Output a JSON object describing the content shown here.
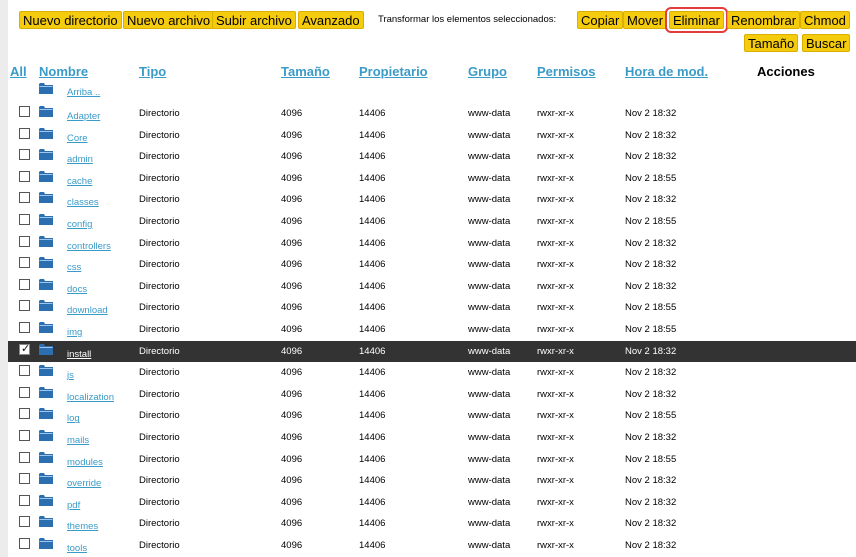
{
  "toolbar": {
    "new_dir": "Nuevo directorio",
    "new_file": "Nuevo archivo",
    "upload": "Subir archivo",
    "advanced": "Avanzado",
    "transform_label": "Transformar los elementos seleccionados:",
    "copy": "Copiar",
    "move": "Mover",
    "delete": "Eliminar",
    "rename": "Renombrar",
    "chmod": "Chmod",
    "size": "Tamaño",
    "search": "Buscar"
  },
  "headers": {
    "all": "All",
    "name": "Nombre",
    "type": "Tipo",
    "size": "Tamaño",
    "owner": "Propietario",
    "group": "Grupo",
    "perms": "Permisos",
    "modified": "Hora de mod.",
    "actions": "Acciones"
  },
  "up_link": "Arriba ..",
  "colors": {
    "button": "#f5cb0d",
    "link": "#3a9bc8",
    "selected_row": "#333333",
    "highlight": "#e23c3c",
    "folder": "#2c6fb0"
  },
  "rows": [
    {
      "name": "Adapter",
      "type": "Directorio",
      "size": "4096",
      "owner": "14406",
      "group": "www-data",
      "perms": "rwxr-xr-x",
      "modified": "Nov 2 18:32",
      "checked": false
    },
    {
      "name": "Core",
      "type": "Directorio",
      "size": "4096",
      "owner": "14406",
      "group": "www-data",
      "perms": "rwxr-xr-x",
      "modified": "Nov 2 18:32",
      "checked": false
    },
    {
      "name": "admin",
      "type": "Directorio",
      "size": "4096",
      "owner": "14406",
      "group": "www-data",
      "perms": "rwxr-xr-x",
      "modified": "Nov 2 18:32",
      "checked": false
    },
    {
      "name": "cache",
      "type": "Directorio",
      "size": "4096",
      "owner": "14406",
      "group": "www-data",
      "perms": "rwxr-xr-x",
      "modified": "Nov 2 18:55",
      "checked": false
    },
    {
      "name": "classes",
      "type": "Directorio",
      "size": "4096",
      "owner": "14406",
      "group": "www-data",
      "perms": "rwxr-xr-x",
      "modified": "Nov 2 18:32",
      "checked": false
    },
    {
      "name": "config",
      "type": "Directorio",
      "size": "4096",
      "owner": "14406",
      "group": "www-data",
      "perms": "rwxr-xr-x",
      "modified": "Nov 2 18:55",
      "checked": false
    },
    {
      "name": "controllers",
      "type": "Directorio",
      "size": "4096",
      "owner": "14406",
      "group": "www-data",
      "perms": "rwxr-xr-x",
      "modified": "Nov 2 18:32",
      "checked": false
    },
    {
      "name": "css",
      "type": "Directorio",
      "size": "4096",
      "owner": "14406",
      "group": "www-data",
      "perms": "rwxr-xr-x",
      "modified": "Nov 2 18:32",
      "checked": false
    },
    {
      "name": "docs",
      "type": "Directorio",
      "size": "4096",
      "owner": "14406",
      "group": "www-data",
      "perms": "rwxr-xr-x",
      "modified": "Nov 2 18:32",
      "checked": false
    },
    {
      "name": "download",
      "type": "Directorio",
      "size": "4096",
      "owner": "14406",
      "group": "www-data",
      "perms": "rwxr-xr-x",
      "modified": "Nov 2 18:55",
      "checked": false
    },
    {
      "name": "img",
      "type": "Directorio",
      "size": "4096",
      "owner": "14406",
      "group": "www-data",
      "perms": "rwxr-xr-x",
      "modified": "Nov 2 18:55",
      "checked": false
    },
    {
      "name": "install",
      "type": "Directorio",
      "size": "4096",
      "owner": "14406",
      "group": "www-data",
      "perms": "rwxr-xr-x",
      "modified": "Nov 2 18:32",
      "checked": true
    },
    {
      "name": "js",
      "type": "Directorio",
      "size": "4096",
      "owner": "14406",
      "group": "www-data",
      "perms": "rwxr-xr-x",
      "modified": "Nov 2 18:32",
      "checked": false
    },
    {
      "name": "localization",
      "type": "Directorio",
      "size": "4096",
      "owner": "14406",
      "group": "www-data",
      "perms": "rwxr-xr-x",
      "modified": "Nov 2 18:32",
      "checked": false
    },
    {
      "name": "log",
      "type": "Directorio",
      "size": "4096",
      "owner": "14406",
      "group": "www-data",
      "perms": "rwxr-xr-x",
      "modified": "Nov 2 18:55",
      "checked": false
    },
    {
      "name": "mails",
      "type": "Directorio",
      "size": "4096",
      "owner": "14406",
      "group": "www-data",
      "perms": "rwxr-xr-x",
      "modified": "Nov 2 18:32",
      "checked": false
    },
    {
      "name": "modules",
      "type": "Directorio",
      "size": "4096",
      "owner": "14406",
      "group": "www-data",
      "perms": "rwxr-xr-x",
      "modified": "Nov 2 18:55",
      "checked": false
    },
    {
      "name": "override",
      "type": "Directorio",
      "size": "4096",
      "owner": "14406",
      "group": "www-data",
      "perms": "rwxr-xr-x",
      "modified": "Nov 2 18:32",
      "checked": false
    },
    {
      "name": "pdf",
      "type": "Directorio",
      "size": "4096",
      "owner": "14406",
      "group": "www-data",
      "perms": "rwxr-xr-x",
      "modified": "Nov 2 18:32",
      "checked": false
    },
    {
      "name": "themes",
      "type": "Directorio",
      "size": "4096",
      "owner": "14406",
      "group": "www-data",
      "perms": "rwxr-xr-x",
      "modified": "Nov 2 18:32",
      "checked": false
    },
    {
      "name": "tools",
      "type": "Directorio",
      "size": "4096",
      "owner": "14406",
      "group": "www-data",
      "perms": "rwxr-xr-x",
      "modified": "Nov 2 18:32",
      "checked": false
    }
  ]
}
